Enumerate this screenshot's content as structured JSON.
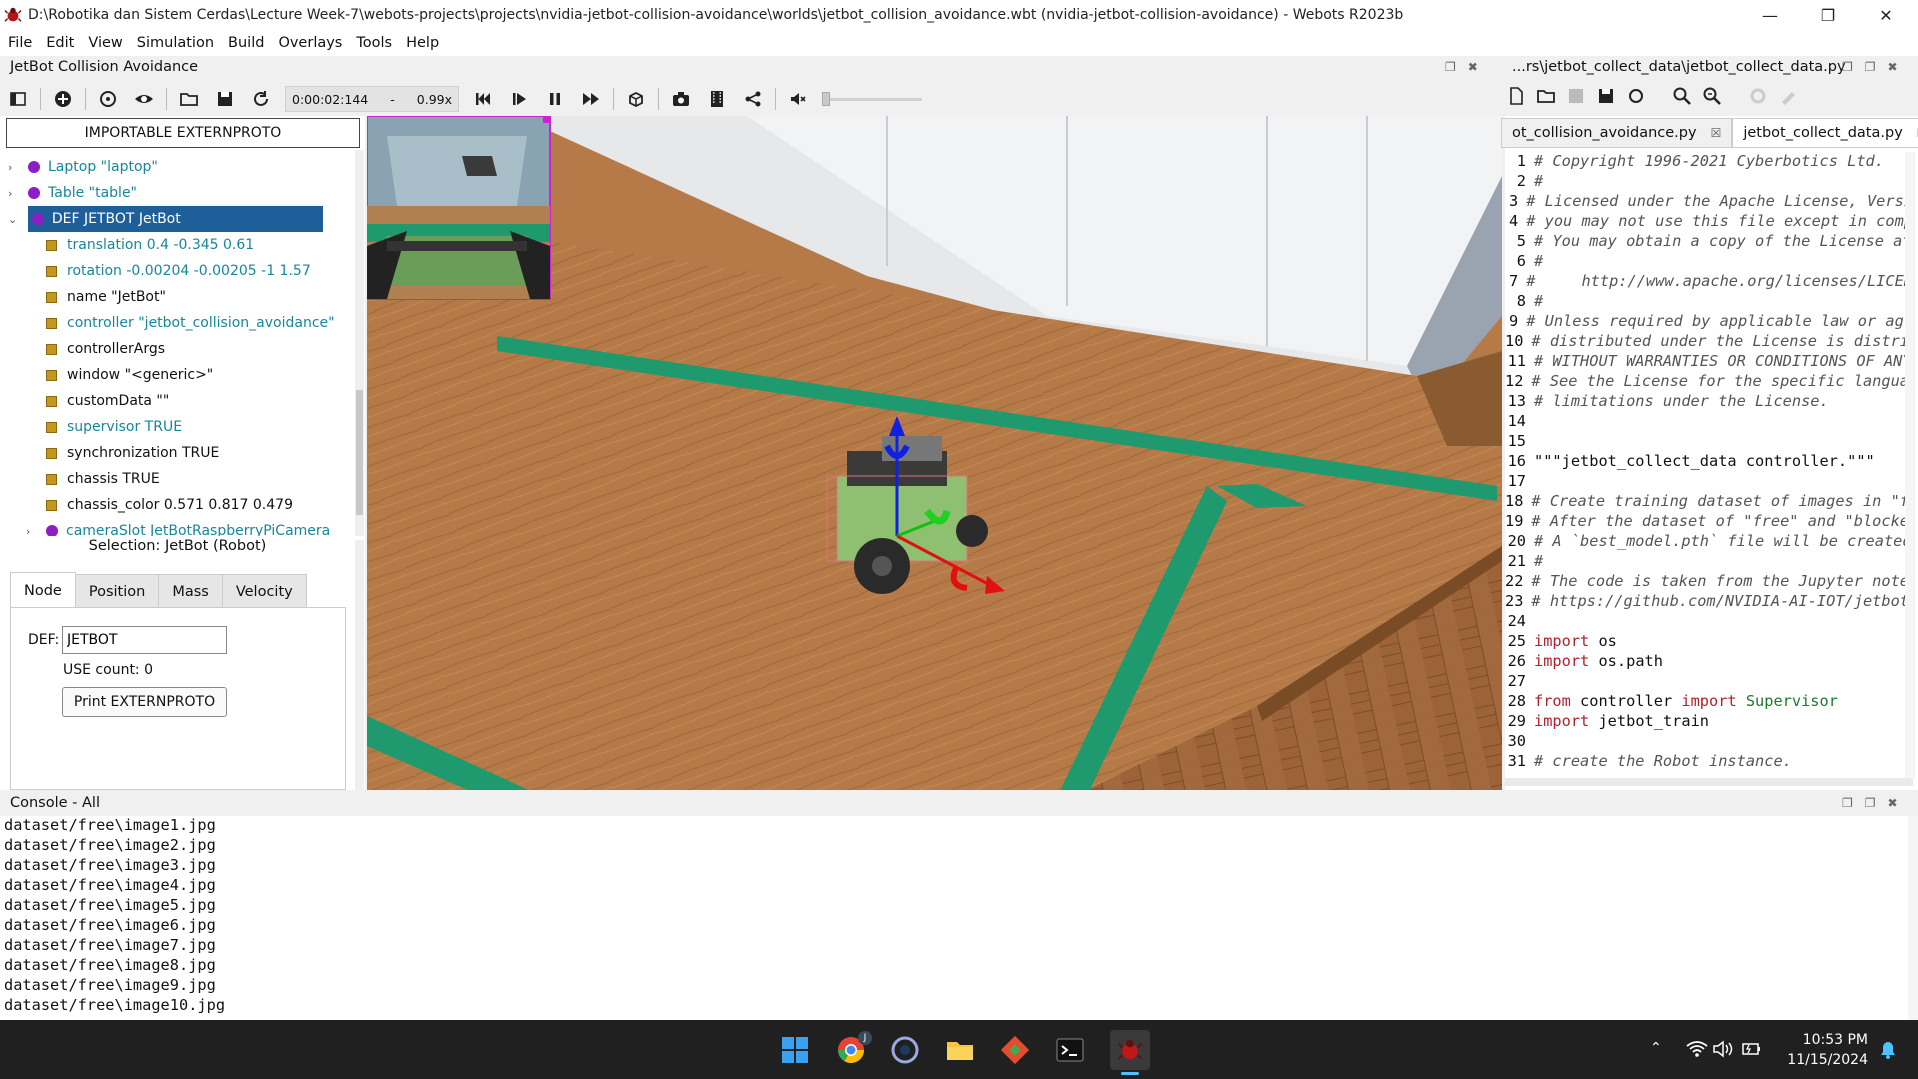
{
  "window": {
    "title": "D:\\Robotika dan Sistem Cerdas\\Lecture Week-7\\webots-projects\\projects\\nvidia-jetbot-collision-avoidance\\worlds\\jetbot_collision_avoidance.wbt (nvidia-jetbot-collision-avoidance) - Webots R2023b"
  },
  "menu": [
    "File",
    "Edit",
    "View",
    "Simulation",
    "Build",
    "Overlays",
    "Tools",
    "Help"
  ],
  "world_panel": {
    "title": "JetBot Collision Avoidance"
  },
  "editor_panel": {
    "title": "...rs\\jetbot_collect_data\\jetbot_collect_data.py"
  },
  "toolbar": {
    "time": "0:00:02:144",
    "separator": "-",
    "speed": "0.99x"
  },
  "scene_tree": {
    "importable_button": "IMPORTABLE EXTERNPROTO",
    "rows": [
      {
        "label": "Laptop \"laptop\""
      },
      {
        "label": "Table \"table\""
      },
      {
        "label": "DEF JETBOT JetBot"
      },
      {
        "label": "translation 0.4 -0.345 0.61"
      },
      {
        "label": "rotation -0.00204 -0.00205 -1 1.57"
      },
      {
        "label": "name \"JetBot\""
      },
      {
        "label": "controller \"jetbot_collision_avoidance\""
      },
      {
        "label": "controllerArgs"
      },
      {
        "label": "window \"<generic>\""
      },
      {
        "label": "customData \"\""
      },
      {
        "label": "supervisor TRUE"
      },
      {
        "label": "synchronization TRUE"
      },
      {
        "label": "chassis TRUE"
      },
      {
        "label": "chassis_color 0.571 0.817 0.479"
      },
      {
        "label": "cameraSlot JetBotRaspberryPiCamera"
      }
    ]
  },
  "selection": {
    "label": "Selection: JetBot (Robot)"
  },
  "node_tabs": [
    "Node",
    "Position",
    "Mass",
    "Velocity"
  ],
  "node_pane": {
    "def_label": "DEF:",
    "def_value": "JETBOT",
    "use_count": "USE count: 0",
    "print_button": "Print EXTERNPROTO"
  },
  "editor_tabs": [
    {
      "label": "ot_collision_avoidance.py"
    },
    {
      "label": "jetbot_collect_data.py"
    }
  ],
  "code_lines": [
    "# Copyright 1996-2021 Cyberbotics Ltd.",
    "#",
    "# Licensed under the Apache License, Versi",
    "# you may not use this file except in comp",
    "# You may obtain a copy of the License at",
    "#",
    "#     http://www.apache.org/licenses/LICEN",
    "#",
    "# Unless required by applicable law or agr",
    "# distributed under the License is distrib",
    "# WITHOUT WARRANTIES OR CONDITIONS OF ANY",
    "# See the License for the specific languag",
    "# limitations under the License.",
    "",
    "",
    "\"\"\"jetbot_collect_data controller.\"\"\"",
    "",
    "# Create training dataset of images in \"fr",
    "# After the dataset of \"free\" and \"blocked",
    "# A `best_model.pth` file will be created",
    "#",
    "# The code is taken from the Jupyter noteb",
    "# https://github.com/NVIDIA-AI-IOT/jetbot/",
    "",
    "import os",
    "import os.path",
    "",
    "from controller import Supervisor",
    "import jetbot_train",
    "",
    "# create the Robot instance."
  ],
  "console": {
    "title": "Console - All",
    "lines": [
      "dataset/free\\image1.jpg",
      "dataset/free\\image2.jpg",
      "dataset/free\\image3.jpg",
      "dataset/free\\image4.jpg",
      "dataset/free\\image5.jpg",
      "dataset/free\\image6.jpg",
      "dataset/free\\image7.jpg",
      "dataset/free\\image8.jpg",
      "dataset/free\\image9.jpg",
      "dataset/free\\image10.jpg"
    ]
  },
  "taskbar": {
    "time": "10:53 PM",
    "date": "11/15/2024",
    "chrome_badge": "J"
  },
  "colors": {
    "selection": "#1e5f9a",
    "field_cyan": "#16879a",
    "table_wood": "#b57a48",
    "green_tape": "#1e9a6e",
    "taskbar": "#202020"
  }
}
